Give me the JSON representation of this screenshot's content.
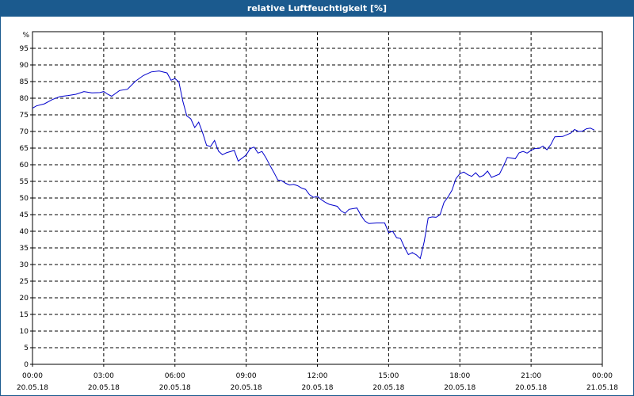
{
  "chart_data": {
    "type": "line",
    "title": "relative Luftfeuchtigkeit [%]",
    "ylabel": "%",
    "ylim": [
      0,
      100
    ],
    "yticks": [
      0,
      5,
      10,
      15,
      20,
      25,
      30,
      35,
      40,
      45,
      50,
      55,
      60,
      65,
      70,
      75,
      80,
      85,
      90,
      95
    ],
    "xlim_hours": [
      0,
      24
    ],
    "x_ticks": [
      {
        "time": "00:00",
        "date": "20.05.18"
      },
      {
        "time": "03:00",
        "date": "20.05.18"
      },
      {
        "time": "06:00",
        "date": "20.05.18"
      },
      {
        "time": "09:00",
        "date": "20.05.18"
      },
      {
        "time": "12:00",
        "date": "20.05.18"
      },
      {
        "time": "15:00",
        "date": "20.05.18"
      },
      {
        "time": "18:00",
        "date": "20.05.18"
      },
      {
        "time": "21:00",
        "date": "20.05.18"
      },
      {
        "time": "00:00",
        "date": "21.05.18"
      }
    ],
    "grid": true,
    "line_color": "#0000cc",
    "series": [
      {
        "points": [
          [
            "00:00",
            77.0
          ],
          [
            "00:10",
            77.7
          ],
          [
            "00:30",
            78.3
          ],
          [
            "00:50",
            79.6
          ],
          [
            "01:10",
            80.5
          ],
          [
            "01:30",
            80.8
          ],
          [
            "01:50",
            81.2
          ],
          [
            "02:10",
            82.0
          ],
          [
            "02:30",
            81.6
          ],
          [
            "02:50",
            81.7
          ],
          [
            "03:00",
            82.0
          ],
          [
            "03:10",
            81.2
          ],
          [
            "03:20",
            80.6
          ],
          [
            "03:40",
            82.3
          ],
          [
            "04:00",
            82.7
          ],
          [
            "04:20",
            85.1
          ],
          [
            "04:40",
            86.8
          ],
          [
            "05:00",
            87.9
          ],
          [
            "05:20",
            88.2
          ],
          [
            "05:40",
            87.6
          ],
          [
            "05:50",
            85.4
          ],
          [
            "06:00",
            85.9
          ],
          [
            "06:10",
            84.9
          ],
          [
            "06:20",
            79.1
          ],
          [
            "06:30",
            74.7
          ],
          [
            "06:40",
            73.8
          ],
          [
            "06:50",
            71.2
          ],
          [
            "07:00",
            72.8
          ],
          [
            "07:10",
            69.6
          ],
          [
            "07:20",
            65.8
          ],
          [
            "07:30",
            65.5
          ],
          [
            "07:40",
            67.3
          ],
          [
            "07:50",
            64.1
          ],
          [
            "08:00",
            63.0
          ],
          [
            "08:10",
            63.6
          ],
          [
            "08:30",
            64.3
          ],
          [
            "08:40",
            61.1
          ],
          [
            "09:00",
            62.9
          ],
          [
            "09:10",
            64.8
          ],
          [
            "09:20",
            65.3
          ],
          [
            "09:30",
            63.5
          ],
          [
            "09:40",
            64.0
          ],
          [
            "09:50",
            62.1
          ],
          [
            "10:00",
            59.8
          ],
          [
            "10:10",
            57.7
          ],
          [
            "10:20",
            55.4
          ],
          [
            "10:30",
            55.2
          ],
          [
            "10:40",
            54.4
          ],
          [
            "10:50",
            53.9
          ],
          [
            "11:00",
            54.1
          ],
          [
            "11:10",
            53.7
          ],
          [
            "11:20",
            53.0
          ],
          [
            "11:30",
            52.6
          ],
          [
            "11:40",
            51.0
          ],
          [
            "11:50",
            50.2
          ],
          [
            "12:00",
            50.5
          ],
          [
            "12:10",
            49.5
          ],
          [
            "12:20",
            48.7
          ],
          [
            "12:30",
            48.1
          ],
          [
            "12:50",
            47.5
          ],
          [
            "13:00",
            46.1
          ],
          [
            "13:10",
            45.4
          ],
          [
            "13:20",
            46.6
          ],
          [
            "13:40",
            47.0
          ],
          [
            "13:50",
            44.8
          ],
          [
            "14:00",
            43.1
          ],
          [
            "14:10",
            42.3
          ],
          [
            "14:30",
            42.5
          ],
          [
            "14:50",
            42.5
          ],
          [
            "15:00",
            39.6
          ],
          [
            "15:10",
            40.0
          ],
          [
            "15:20",
            38.1
          ],
          [
            "15:30",
            37.8
          ],
          [
            "15:40",
            35.2
          ],
          [
            "15:50",
            33.0
          ],
          [
            "16:00",
            33.6
          ],
          [
            "16:10",
            32.9
          ],
          [
            "16:20",
            31.8
          ],
          [
            "16:30",
            36.9
          ],
          [
            "16:40",
            44.0
          ],
          [
            "16:50",
            44.3
          ],
          [
            "17:00",
            44.2
          ],
          [
            "17:10",
            45.0
          ],
          [
            "17:20",
            48.7
          ],
          [
            "17:30",
            50.3
          ],
          [
            "17:40",
            52.3
          ],
          [
            "17:50",
            55.8
          ],
          [
            "18:00",
            57.3
          ],
          [
            "18:10",
            57.8
          ],
          [
            "18:20",
            57.0
          ],
          [
            "18:30",
            56.5
          ],
          [
            "18:40",
            57.6
          ],
          [
            "18:50",
            56.3
          ],
          [
            "19:00",
            56.8
          ],
          [
            "19:10",
            58.1
          ],
          [
            "19:20",
            56.2
          ],
          [
            "19:40",
            57.2
          ],
          [
            "19:50",
            59.6
          ],
          [
            "20:00",
            62.2
          ],
          [
            "20:20",
            61.8
          ],
          [
            "20:30",
            63.6
          ],
          [
            "20:40",
            64.0
          ],
          [
            "20:50",
            63.5
          ],
          [
            "21:00",
            64.3
          ],
          [
            "21:10",
            64.9
          ],
          [
            "21:20",
            64.9
          ],
          [
            "21:30",
            65.6
          ],
          [
            "21:40",
            64.5
          ],
          [
            "21:50",
            66.1
          ],
          [
            "22:00",
            68.4
          ],
          [
            "22:20",
            68.5
          ],
          [
            "22:40",
            69.5
          ],
          [
            "22:50",
            70.6
          ],
          [
            "23:00",
            70.0
          ],
          [
            "23:10",
            70.1
          ],
          [
            "23:20",
            70.8
          ],
          [
            "23:30",
            71.0
          ],
          [
            "23:40",
            70.4
          ]
        ]
      }
    ]
  }
}
